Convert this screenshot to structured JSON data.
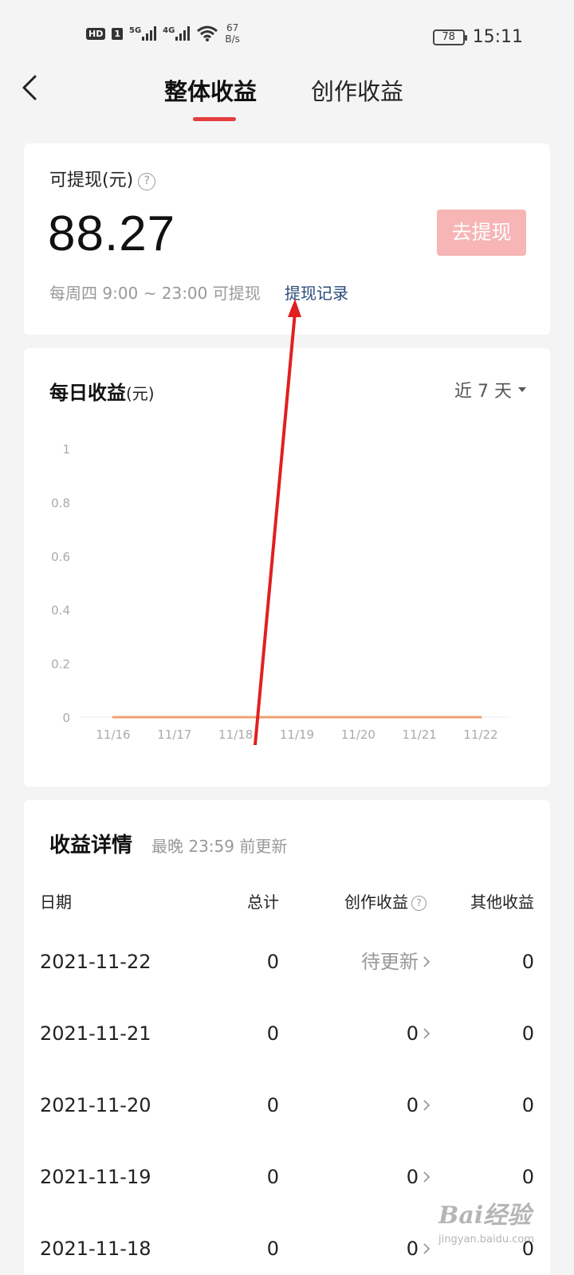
{
  "status_bar": {
    "hd": "HD",
    "sim": "1",
    "net1": "5G",
    "net2": "4G",
    "speed_value": "67",
    "speed_unit": "B/s",
    "battery": "78",
    "time": "15:11"
  },
  "header": {
    "tabs": [
      {
        "label": "整体收益",
        "active": true
      },
      {
        "label": "创作收益",
        "active": false
      }
    ],
    "accent_color": "#e33d3d"
  },
  "balance": {
    "label": "可提现(元)",
    "amount": "88.27",
    "withdraw_button": "去提现",
    "hint": "每周四 9:00 ~ 23:00 可提现",
    "records_link": "提现记录"
  },
  "chart_section": {
    "title": "每日收益",
    "unit": "(元)",
    "range_label": "近 7 天"
  },
  "chart_data": {
    "type": "line",
    "x": [
      "11/16",
      "11/17",
      "11/18",
      "11/19",
      "11/20",
      "11/21",
      "11/22"
    ],
    "values": [
      0,
      0,
      0,
      0,
      0,
      0,
      0
    ],
    "y_ticks": [
      "1",
      "0.8",
      "0.6",
      "0.4",
      "0.2",
      "0"
    ],
    "ylim": [
      0,
      1
    ],
    "line_color": "#f0a070",
    "grid": false
  },
  "details": {
    "title": "收益详情",
    "subtitle": "最晚 23:59 前更新",
    "columns": {
      "date": "日期",
      "total": "总计",
      "creation": "创作收益",
      "other": "其他收益"
    },
    "rows": [
      {
        "date": "2021-11-22",
        "total": "0",
        "creation": "待更新",
        "other": "0"
      },
      {
        "date": "2021-11-21",
        "total": "0",
        "creation": "0",
        "other": "0"
      },
      {
        "date": "2021-11-20",
        "total": "0",
        "creation": "0",
        "other": "0"
      },
      {
        "date": "2021-11-19",
        "total": "0",
        "creation": "0",
        "other": "0"
      },
      {
        "date": "2021-11-18",
        "total": "0",
        "creation": "0",
        "other": "0"
      }
    ]
  },
  "watermark": {
    "main": "Bai经验",
    "sub": "jingyan.baidu.com"
  }
}
